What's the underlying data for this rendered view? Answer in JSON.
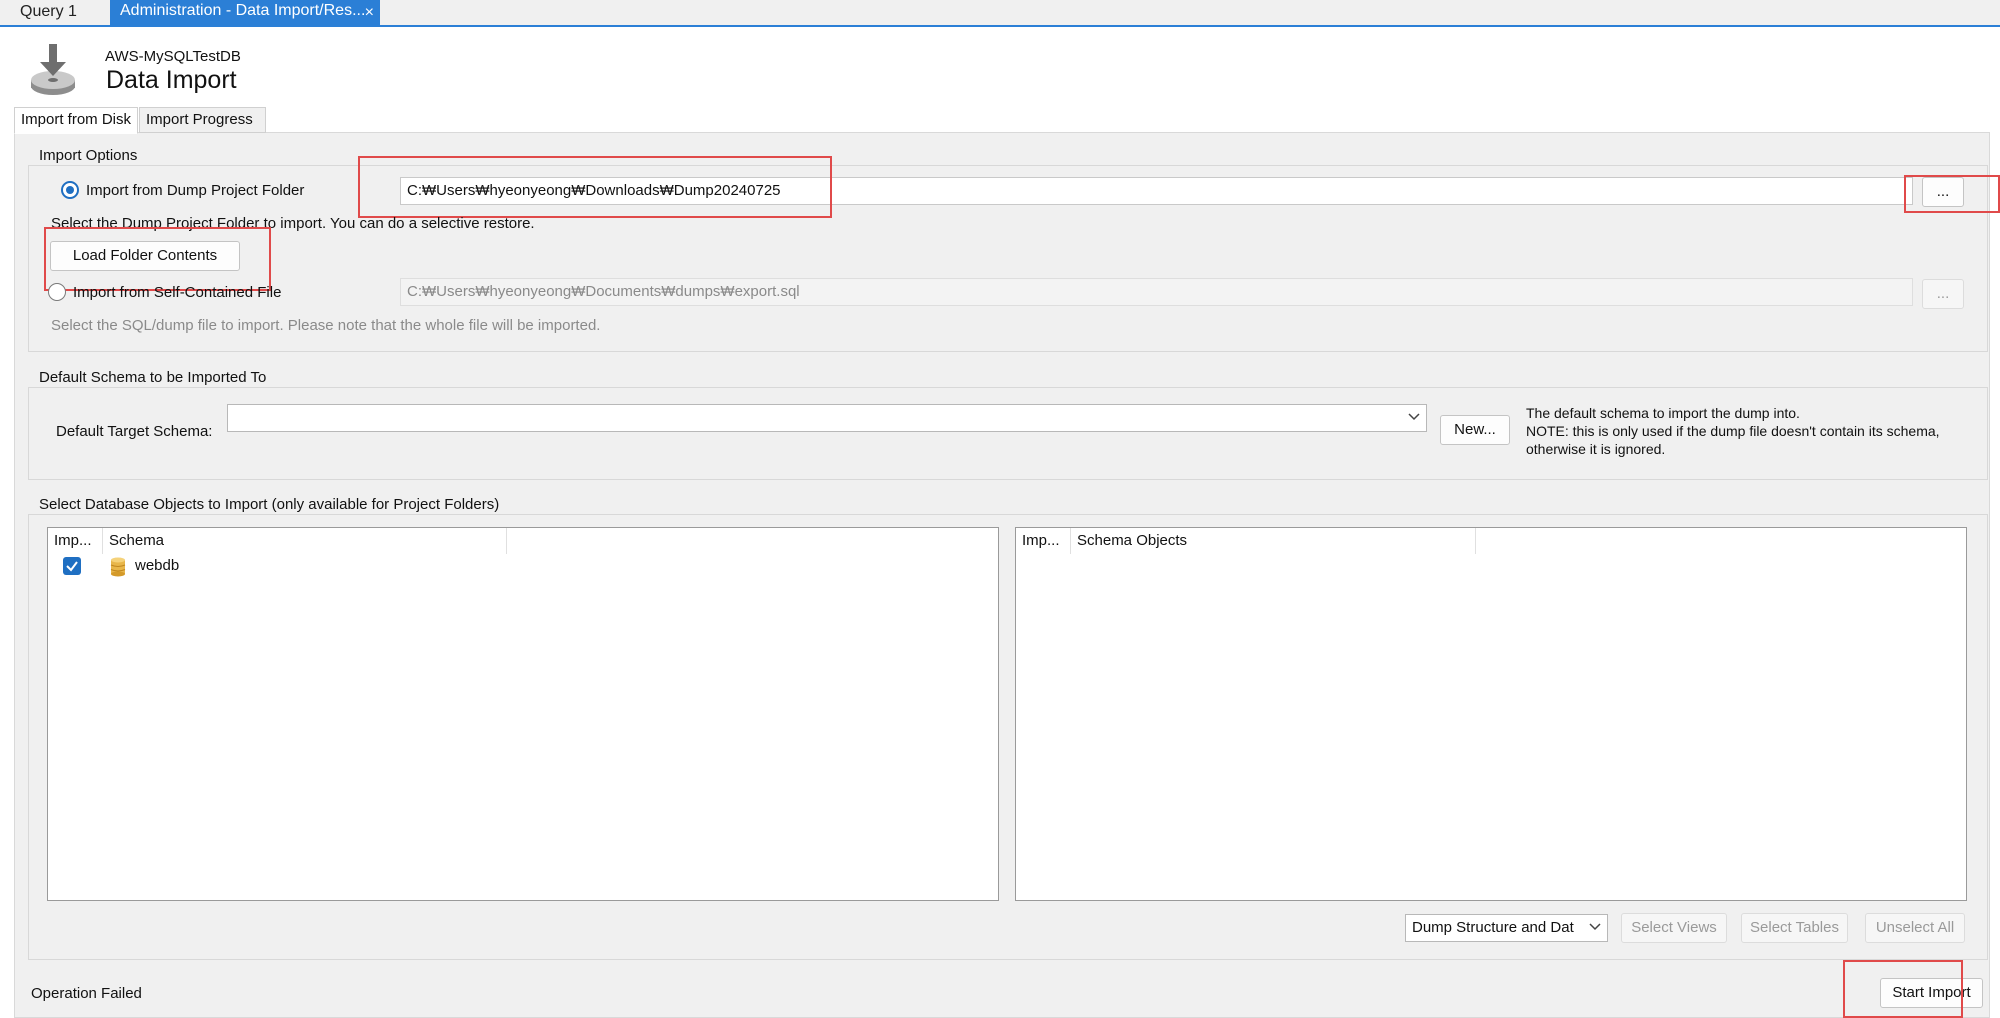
{
  "tabs": {
    "query_tab": "Query 1",
    "admin_tab": "Administration - Data Import/Res...",
    "close_glyph": "×"
  },
  "header": {
    "connection": "AWS-MySQLTestDB",
    "title": "Data Import"
  },
  "subtabs": {
    "import_from_disk": "Import from Disk",
    "import_progress": "Import Progress"
  },
  "import_options": {
    "group_title": "Import Options",
    "dump_folder_radio": "Import from Dump Project Folder",
    "dump_folder_path": "C:₩Users₩hyeonyeong₩Downloads₩Dump20240725",
    "browse_label": "...",
    "dump_folder_hint": "Select the Dump Project Folder to import. You can do a selective restore.",
    "load_folder_button": "Load Folder Contents",
    "self_contained_radio": "Import from Self-Contained File",
    "self_contained_path": "C:₩Users₩hyeonyeong₩Documents₩dumps₩export.sql",
    "self_contained_browse": "...",
    "self_contained_hint": "Select the SQL/dump file to import. Please note that the whole file will be imported."
  },
  "default_schema": {
    "group_title": "Default Schema to be Imported To",
    "label": "Default Target Schema:",
    "value": "",
    "new_button": "New...",
    "note_line1": "The default schema to import the dump into.",
    "note_line2": "NOTE: this is only used if the dump file doesn't contain its schema,",
    "note_line3": "otherwise it is ignored."
  },
  "objects": {
    "group_title": "Select Database Objects to Import (only available for Project Folders)",
    "left_headers": [
      "Imp...",
      "Schema"
    ],
    "right_headers": [
      "Imp...",
      "Schema Objects"
    ],
    "schemas": [
      {
        "checked": true,
        "name": "webdb"
      }
    ],
    "dump_mode": "Dump Structure and Dat",
    "select_views": "Select Views",
    "select_tables": "Select Tables",
    "unselect_all": "Unselect All"
  },
  "footer": {
    "status": "Operation Failed",
    "start_import": "Start Import"
  },
  "colors": {
    "accent": "#2b7fd6",
    "highlight_box": "#e04a4a",
    "panel_bg": "#f0f0f0"
  }
}
